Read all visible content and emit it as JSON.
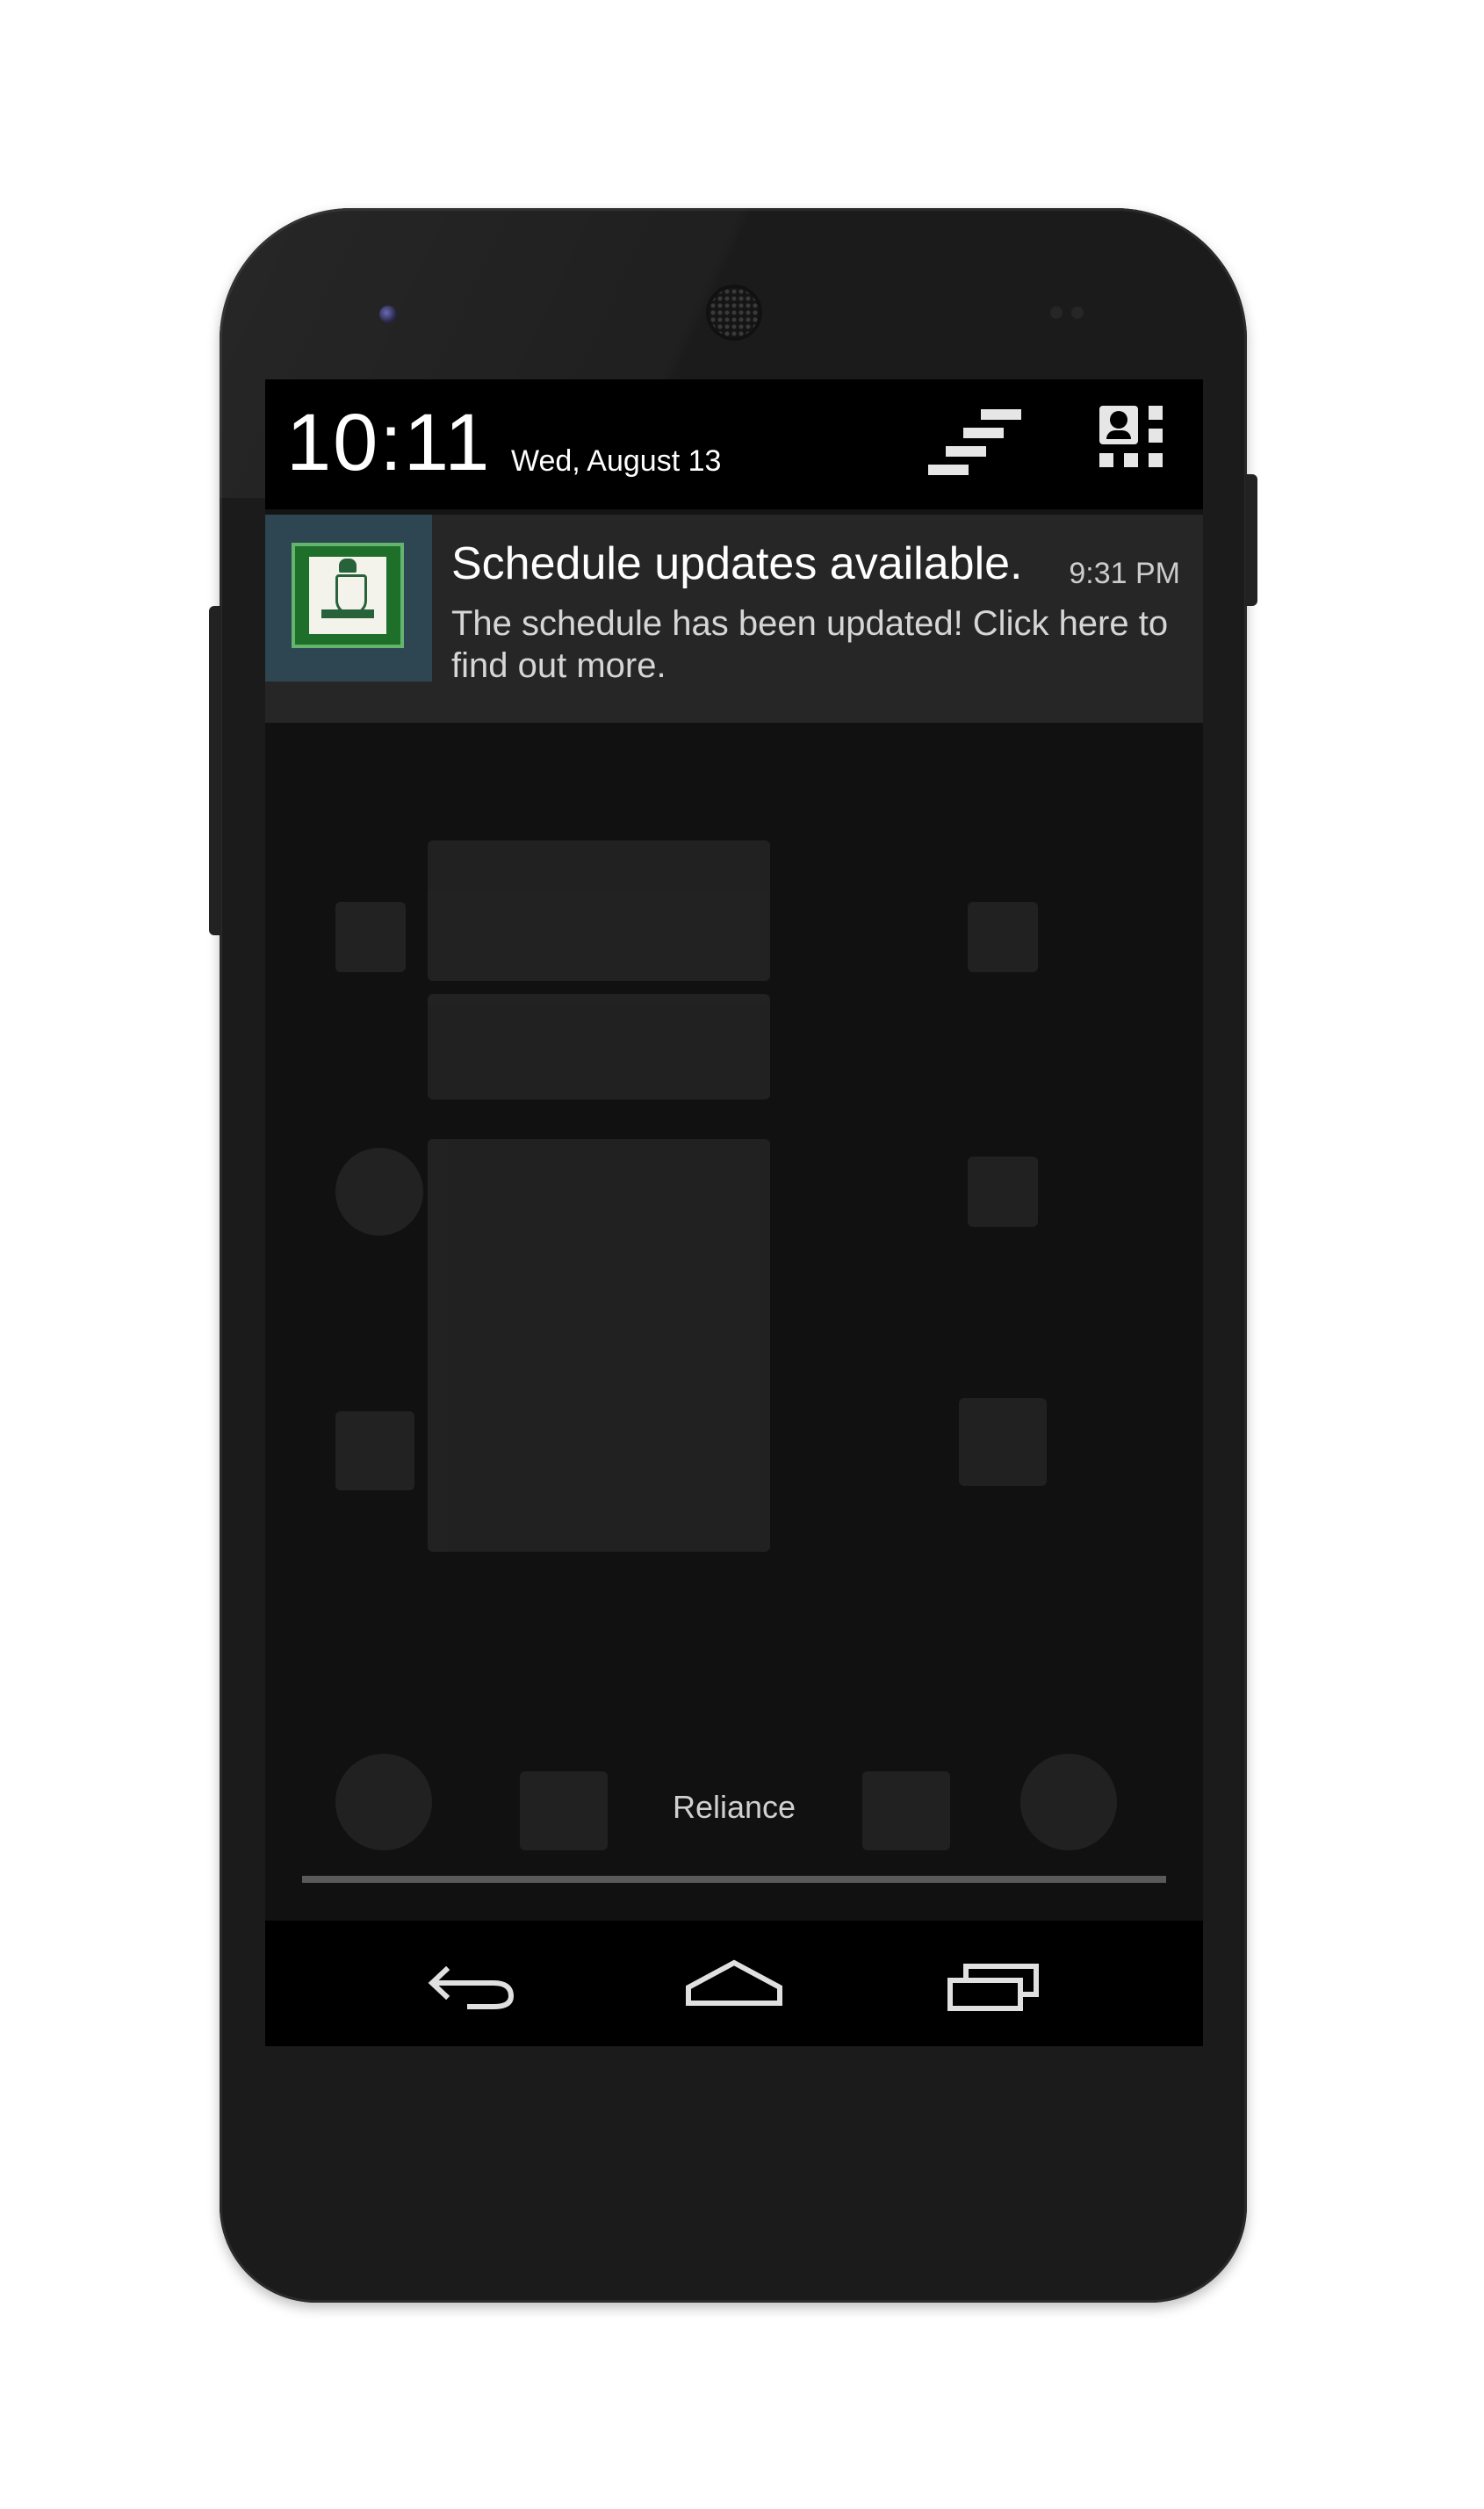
{
  "status_header": {
    "time": "10:11",
    "date": "Wed, August 13",
    "settings_icon": "notification-settings-icon",
    "quick_settings_icon": "quick-settings-icon"
  },
  "notification": {
    "app_icon": "school-crest-icon",
    "title": "Schedule updates available.",
    "time": "9:31 PM",
    "text": "The schedule has been updated! Click here to find out more."
  },
  "carrier": "Reliance",
  "nav": {
    "back_icon": "back-icon",
    "home_icon": "home-icon",
    "recents_icon": "recents-icon"
  },
  "colors": {
    "screen_bg": "#111111",
    "header_bg": "#000000",
    "notification_bg": "#262626",
    "icon_bg": "#2d4651",
    "icon_green": "#1e6f2a"
  }
}
